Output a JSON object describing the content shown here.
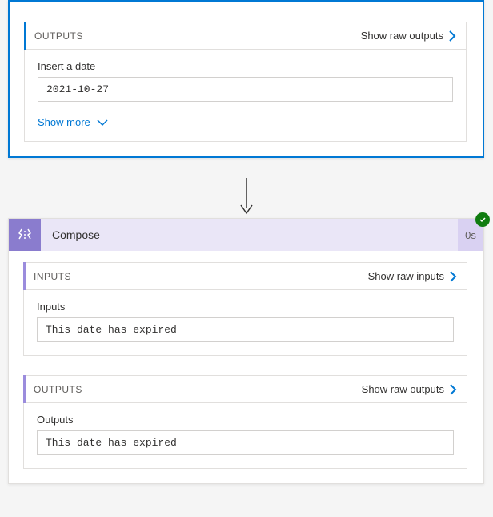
{
  "card1": {
    "outputs": {
      "title": "OUTPUTS",
      "raw_link": "Show raw outputs",
      "field_label": "Insert a date",
      "field_value": "2021-10-27",
      "show_more": "Show more"
    }
  },
  "compose": {
    "title": "Compose",
    "duration": "0s",
    "inputs": {
      "title": "INPUTS",
      "raw_link": "Show raw inputs",
      "field_label": "Inputs",
      "field_value": "This date has expired"
    },
    "outputs": {
      "title": "OUTPUTS",
      "raw_link": "Show raw outputs",
      "field_label": "Outputs",
      "field_value": "This date has expired"
    }
  }
}
